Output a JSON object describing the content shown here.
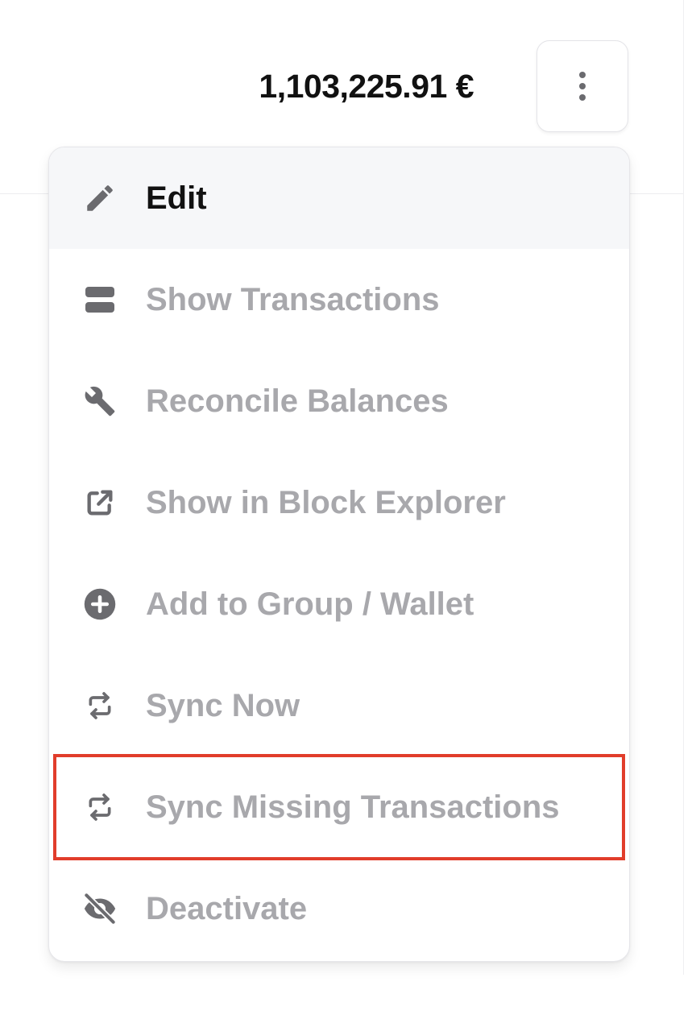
{
  "balance": {
    "amount": "1,103,225.91 €"
  },
  "more_button": {
    "icon": "vertical-dots-icon"
  },
  "menu": {
    "items": [
      {
        "label": "Edit",
        "icon": "pencil-icon",
        "active": true
      },
      {
        "label": "Show Transactions",
        "icon": "server-stack-icon"
      },
      {
        "label": "Reconcile Balances",
        "icon": "wrench-icon"
      },
      {
        "label": "Show in Block Explorer",
        "icon": "external-link-icon"
      },
      {
        "label": "Add to Group / Wallet",
        "icon": "plus-circle-icon"
      },
      {
        "label": "Sync Now",
        "icon": "sync-icon"
      },
      {
        "label": "Sync Missing Transactions",
        "icon": "sync-icon",
        "highlighted": true
      },
      {
        "label": "Deactivate",
        "icon": "eye-slash-icon"
      }
    ]
  },
  "colors": {
    "highlight_border": "#e13d2b",
    "active_text": "#111111",
    "disabled_text": "#a8a8ac",
    "icon": "#6b6b6f",
    "active_background": "#f6f7f9"
  }
}
